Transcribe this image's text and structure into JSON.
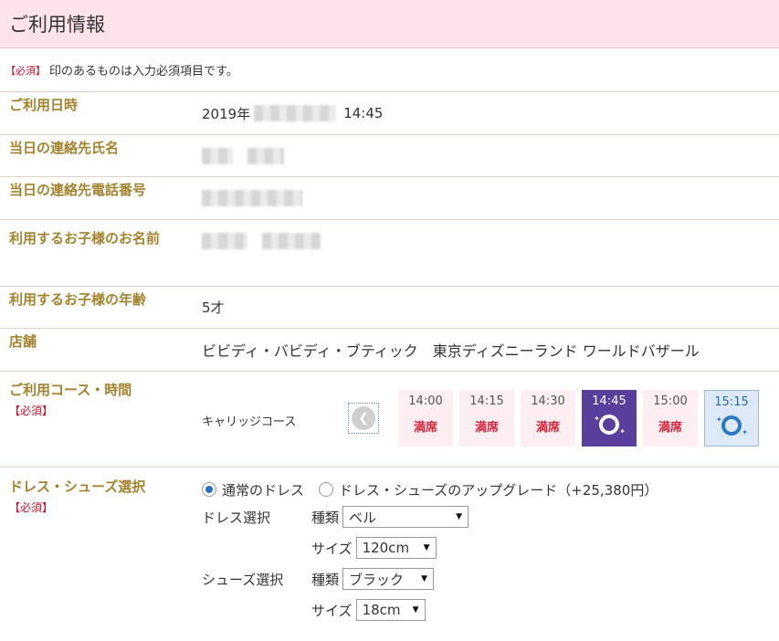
{
  "header": {
    "title": "ご利用情報"
  },
  "notice": {
    "req_tag": "【必須】",
    "text": "印のあるものは入力必須項目です。"
  },
  "rows": {
    "datetime": {
      "label": "ご利用日時",
      "year": "2019年",
      "time": "14:45"
    },
    "contact_name": {
      "label": "当日の連絡先氏名"
    },
    "contact_phone": {
      "label": "当日の連絡先電話番号"
    },
    "child_name": {
      "label": "利用するお子様のお名前"
    },
    "child_age": {
      "label": "利用するお子様の年齢",
      "value": "5才"
    },
    "store": {
      "label": "店舗",
      "value": "ビビディ・バビディ・ブティック　東京ディズニーランド ワールドバザール"
    },
    "course": {
      "label": "ご利用コース・時間",
      "req": "【必須】",
      "course_name": "キャリッジコース",
      "prev_icon": "chevron-left-icon",
      "slots": [
        {
          "time": "14:00",
          "status": "満席",
          "state": "full"
        },
        {
          "time": "14:15",
          "status": "満席",
          "state": "full"
        },
        {
          "time": "14:30",
          "status": "満席",
          "state": "full"
        },
        {
          "time": "14:45",
          "status": "",
          "state": "selected"
        },
        {
          "time": "15:00",
          "status": "満席",
          "state": "full"
        },
        {
          "time": "15:15",
          "status": "",
          "state": "available"
        }
      ]
    },
    "dress": {
      "label": "ドレス・シューズ選択",
      "req": "【必須】",
      "option_normal": "通常のドレス",
      "option_upgrade": "ドレス・シューズのアップグレード（+25,380円）",
      "dress_select_label": "ドレス選択",
      "shoes_select_label": "シューズ選択",
      "type_label": "種類",
      "size_label": "サイズ",
      "dress_type": "ベル",
      "dress_size": "120cm",
      "shoes_type": "ブラック",
      "shoes_size": "18cm"
    }
  },
  "colors": {
    "header_bg": "#fde3ea",
    "label_gold": "#a3832d",
    "required_red": "#c8102e",
    "selected_purple": "#5a3e9c",
    "available_blue": "#2c78c4"
  }
}
